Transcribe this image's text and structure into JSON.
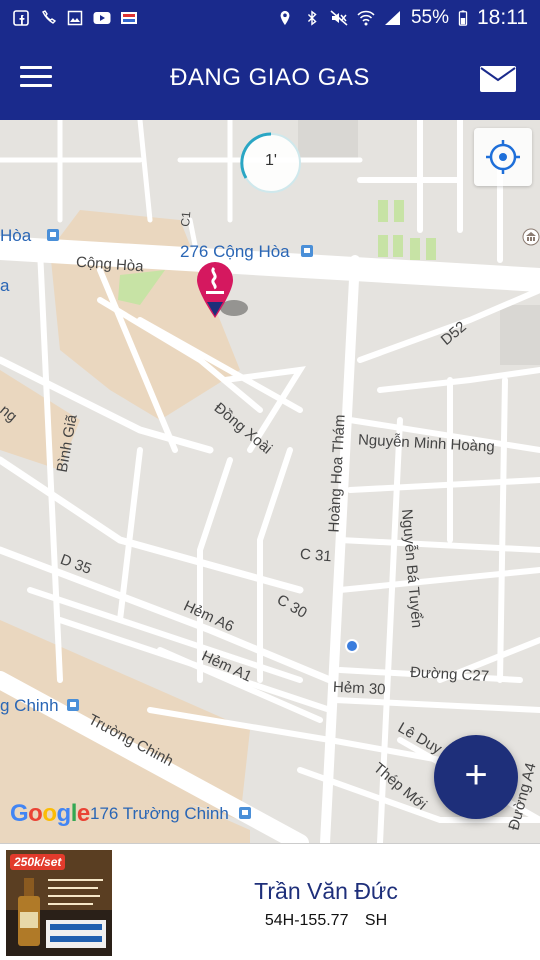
{
  "status_bar": {
    "battery_percent": "55%",
    "time": "18:11",
    "left_icons": [
      "facebook-icon",
      "missed-call-icon",
      "gallery-icon",
      "youtube-icon",
      "news-icon"
    ],
    "right_icons": [
      "location-icon",
      "bluetooth-icon",
      "mute-icon",
      "wifi-icon",
      "signal-icon",
      "battery-icon"
    ]
  },
  "header": {
    "title": "ĐANG GIAO GAS",
    "menu_icon": "hamburger-icon",
    "mail_icon": "mail-icon",
    "background": "#1a2a8c"
  },
  "map": {
    "timer_text": "1'",
    "labels": {
      "cong_hoa_276": "276 Cộng Hòa",
      "hoa_left": "Hòa",
      "cong_hoa": "Cộng Hòa",
      "c1": "C1",
      "a_left": "a",
      "d52": "D52",
      "dong_xoai": "Đồng Xoài",
      "ng_left": "ng",
      "binh_gia": "Bình Giã",
      "nguyen_minh_hoang": "Nguyễn Minh Hoàng",
      "hoang_hoa_tham": "Hoàng Hoa Thám",
      "nguyen_ba_tuyen": "Nguyễn Bá Tuyển",
      "c31": "C 31",
      "d35": "D 35",
      "c30": "C 30",
      "hem_a6": "Hẻm A6",
      "hem_a1": "Hẻm A1",
      "hem_30": "Hẻm 30",
      "duong_c27": "Đường C27",
      "chinh_left": "g Chinh",
      "truong_chinh": "Trường Chinh",
      "le_duy": "Lê Duy",
      "thep_moi": "Thép Mới",
      "duong_a4": "Đường A4",
      "truong_chinh_176": "176 Trường Chinh"
    },
    "locate_icon": "my-location-icon",
    "fab_label": "+",
    "fab_icon": "plus-icon",
    "google_logo": "Google",
    "marker_icon": "gas-marker-icon",
    "accent": "#1e2f7a"
  },
  "bottom_card": {
    "ad_badge": "250k/set",
    "driver_name": "Trần Văn Đức",
    "plate": "54H-155.77",
    "vehicle": "SH"
  }
}
